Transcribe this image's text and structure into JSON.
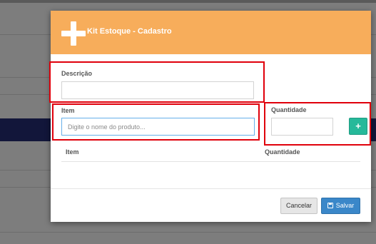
{
  "modal": {
    "title": "Kit Estoque - Cadastro",
    "header_icon": "plus-icon",
    "header_color": "#f7ad5b"
  },
  "form": {
    "descricao": {
      "label": "Descrição",
      "value": "",
      "placeholder": ""
    },
    "item": {
      "label": "Item",
      "value": "",
      "placeholder": "Digite o nome do produto..."
    },
    "quantidade": {
      "label": "Quantidade",
      "value": "",
      "placeholder": ""
    },
    "add_button": {
      "label": "+",
      "icon": "plus-icon",
      "color": "#26b99a"
    }
  },
  "table": {
    "columns": [
      "Item",
      "Quantidade"
    ],
    "rows": []
  },
  "footer": {
    "cancel_label": "Cancelar",
    "save_label": "Salvar",
    "save_icon": "floppy-disk-icon",
    "save_color": "#3a87c9"
  },
  "annotations": {
    "highlight_color": "#e0000b"
  }
}
